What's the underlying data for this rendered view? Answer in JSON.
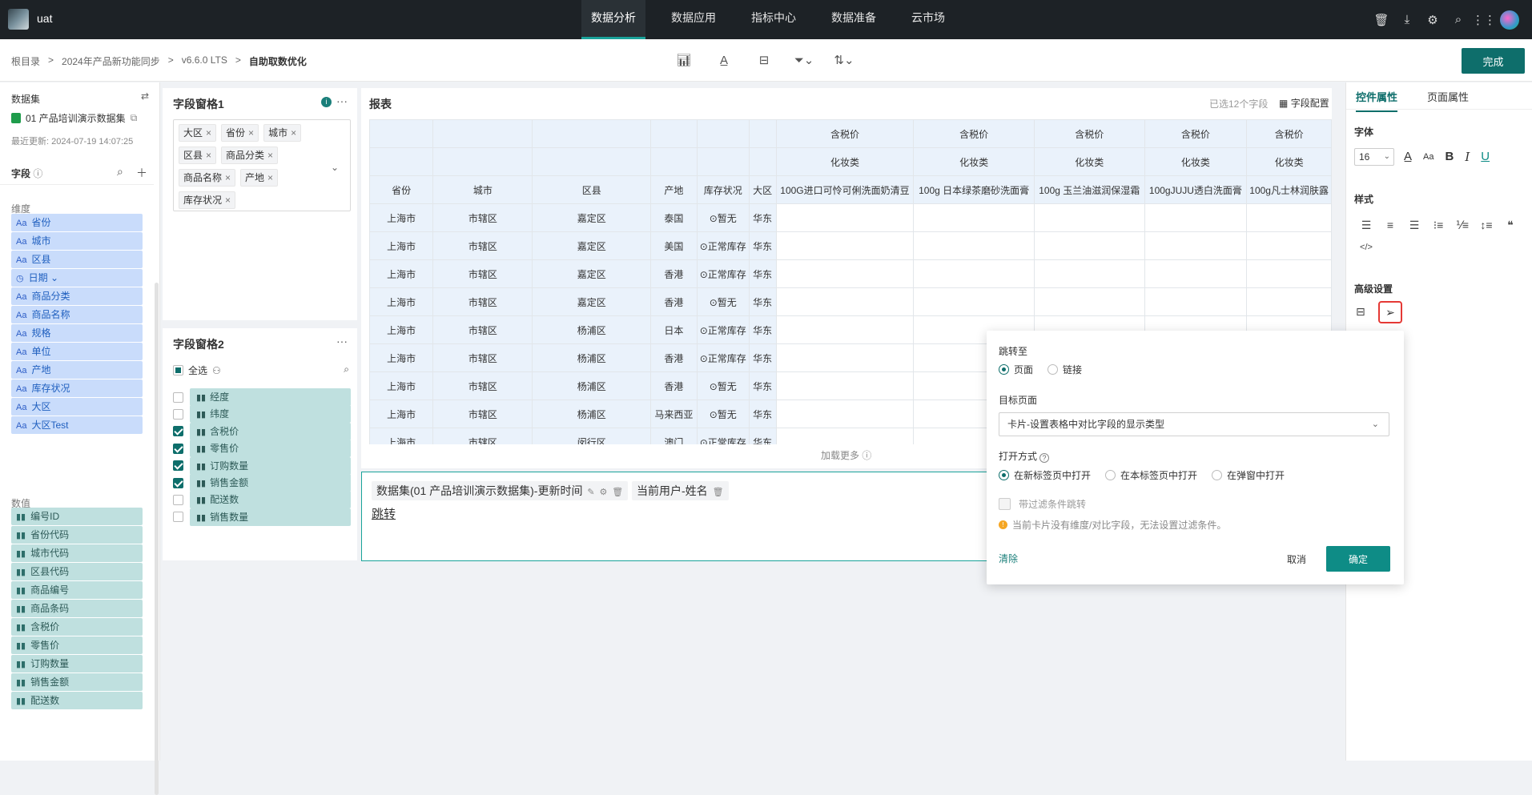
{
  "app": {
    "name": "uat"
  },
  "topnav": [
    "数据分析",
    "数据应用",
    "指标中心",
    "数据准备",
    "云市场"
  ],
  "breadcrumb": [
    "根目录",
    ">",
    "2024年产品新功能同步",
    ">",
    "v6.6.0 LTS",
    ">",
    "自助取数优化"
  ],
  "done_label": "完成",
  "left": {
    "dataset_title": "数据集",
    "dataset_name": "01 产品培训演示数据集",
    "last_update": "最近更新: 2024-07-19 14:07:25",
    "field_title": "字段",
    "dim_group": "维度",
    "dims": [
      {
        "t": "Aa",
        "n": "省份"
      },
      {
        "t": "Aa",
        "n": "城市"
      },
      {
        "t": "Aa",
        "n": "区县"
      },
      {
        "t": "◷",
        "n": "日期 ⌄"
      },
      {
        "t": "Aa",
        "n": "商品分类"
      },
      {
        "t": "Aa",
        "n": "商品名称"
      },
      {
        "t": "Aa",
        "n": "规格"
      },
      {
        "t": "Aa",
        "n": "单位"
      },
      {
        "t": "Aa",
        "n": "产地"
      },
      {
        "t": "Aa",
        "n": "库存状况"
      },
      {
        "t": "Aa",
        "n": "大区"
      },
      {
        "t": "Aa",
        "n": "大区Test"
      }
    ],
    "num_group": "数值",
    "nums": [
      "编号ID",
      "省份代码",
      "城市代码",
      "区县代码",
      "商品编号",
      "商品条码",
      "含税价",
      "零售价",
      "订购数量",
      "销售金额",
      "配送数"
    ]
  },
  "pane1": {
    "title": "字段窗格1",
    "tags": [
      "大区",
      "省份",
      "城市",
      "区县",
      "商品分类",
      "商品名称",
      "产地",
      "库存状况"
    ]
  },
  "pane2": {
    "title": "字段窗格2",
    "select_all": "全选",
    "items": [
      {
        "n": "经度",
        "on": false
      },
      {
        "n": "纬度",
        "on": false
      },
      {
        "n": "含税价",
        "on": true
      },
      {
        "n": "零售价",
        "on": true
      },
      {
        "n": "订购数量",
        "on": true
      },
      {
        "n": "销售金额",
        "on": true
      },
      {
        "n": "配送数",
        "on": false
      },
      {
        "n": "销售数量",
        "on": false
      }
    ]
  },
  "report": {
    "title": "报表",
    "selected": "已选12个字段",
    "config": "字段配置",
    "load_more": "加载更多",
    "measure_label": "含税价",
    "category_label": "化妆类",
    "columns": [
      "省份",
      "城市",
      "区县",
      "产地",
      "库存状况",
      "大区"
    ],
    "products": [
      "100G进口可怜可俐洗面奶清豆",
      "100g 日本绿茶磨砂洗面膏",
      "100g 玉兰油滋润保湿霜",
      "100gJUJU透白洗面膏",
      "100g凡士林润肤露"
    ],
    "rows": [
      [
        "上海市",
        "市辖区",
        "嘉定区",
        "泰国",
        "⊙暂无",
        "华东"
      ],
      [
        "上海市",
        "市辖区",
        "嘉定区",
        "美国",
        "⊙正常库存",
        "华东"
      ],
      [
        "上海市",
        "市辖区",
        "嘉定区",
        "香港",
        "⊙正常库存",
        "华东"
      ],
      [
        "上海市",
        "市辖区",
        "嘉定区",
        "香港",
        "⊙暂无",
        "华东"
      ],
      [
        "上海市",
        "市辖区",
        "杨浦区",
        "日本",
        "⊙正常库存",
        "华东"
      ],
      [
        "上海市",
        "市辖区",
        "杨浦区",
        "香港",
        "⊙正常库存",
        "华东"
      ],
      [
        "上海市",
        "市辖区",
        "杨浦区",
        "香港",
        "⊙暂无",
        "华东"
      ],
      [
        "上海市",
        "市辖区",
        "杨浦区",
        "马来西亚",
        "⊙暂无",
        "华东"
      ],
      [
        "上海市",
        "市辖区",
        "闵行区",
        "澳门",
        "⊙正常库存",
        "华东"
      ]
    ]
  },
  "textcard": {
    "chip1": "数据集(01 产品培训演示数据集)-更新时间",
    "chip2": "当前用户-姓名",
    "link_text": "跳转"
  },
  "right": {
    "tab1": "控件属性",
    "tab2": "页面属性",
    "font_title": "字体",
    "font_size": "16",
    "style_title": "样式",
    "adv_title": "高级设置"
  },
  "popover": {
    "jump_to": "跳转至",
    "opt_page": "页面",
    "opt_link": "链接",
    "target_label": "目标页面",
    "target_value": "卡片-设置表格中对比字段的显示类型",
    "open_mode": "打开方式",
    "mode1": "在新标签页中打开",
    "mode2": "在本标签页中打开",
    "mode3": "在弹窗中打开",
    "filter_label": "带过滤条件跳转",
    "warning": "当前卡片没有维度/对比字段，无法设置过滤条件。",
    "clear": "清除",
    "cancel": "取消",
    "ok": "确定"
  }
}
